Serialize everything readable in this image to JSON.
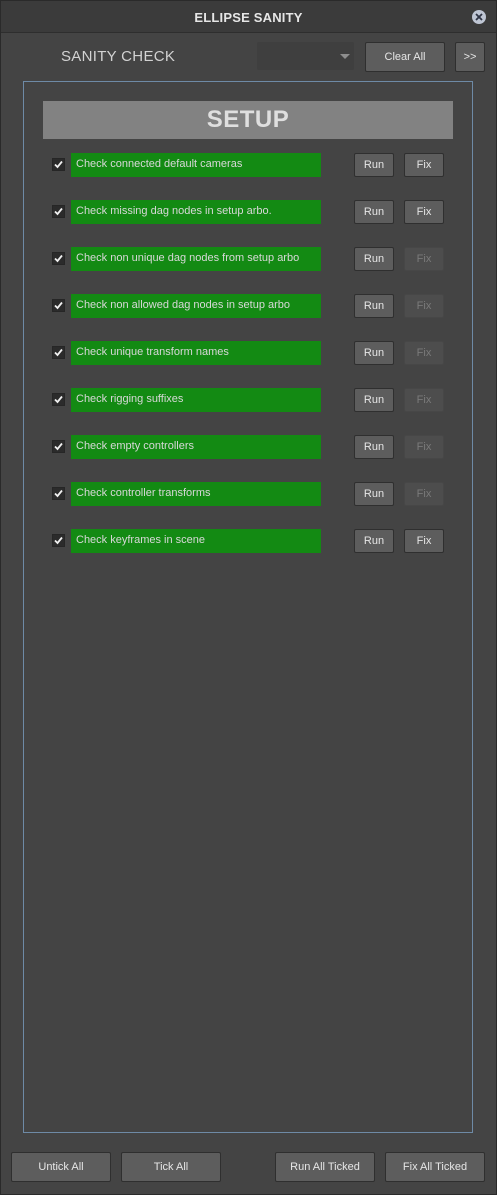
{
  "window": {
    "title": "ELLIPSE SANITY",
    "close_icon": "close-icon"
  },
  "toolbar": {
    "heading": "SANITY CHECK",
    "combo_value": "",
    "clear_all_label": "Clear All",
    "more_label": ">>"
  },
  "section": {
    "title": "SETUP"
  },
  "checks": [
    {
      "label": "Check connected default cameras",
      "checked": true,
      "run_label": "Run",
      "fix_label": "Fix",
      "fix_enabled": true
    },
    {
      "label": "Check missing dag nodes in setup arbo.",
      "checked": true,
      "run_label": "Run",
      "fix_label": "Fix",
      "fix_enabled": true
    },
    {
      "label": "Check non unique dag nodes from setup arbo",
      "checked": true,
      "run_label": "Run",
      "fix_label": "Fix",
      "fix_enabled": false
    },
    {
      "label": "Check non allowed dag nodes in setup arbo",
      "checked": true,
      "run_label": "Run",
      "fix_label": "Fix",
      "fix_enabled": false
    },
    {
      "label": "Check unique transform names",
      "checked": true,
      "run_label": "Run",
      "fix_label": "Fix",
      "fix_enabled": false
    },
    {
      "label": "Check rigging suffixes",
      "checked": true,
      "run_label": "Run",
      "fix_label": "Fix",
      "fix_enabled": false
    },
    {
      "label": "Check empty controllers",
      "checked": true,
      "run_label": "Run",
      "fix_label": "Fix",
      "fix_enabled": false
    },
    {
      "label": "Check controller transforms",
      "checked": true,
      "run_label": "Run",
      "fix_label": "Fix",
      "fix_enabled": false
    },
    {
      "label": "Check keyframes in scene",
      "checked": true,
      "run_label": "Run",
      "fix_label": "Fix",
      "fix_enabled": true
    }
  ],
  "footer": {
    "untick_all_label": "Untick All",
    "tick_all_label": "Tick All",
    "run_all_label": "Run All Ticked",
    "fix_all_label": "Fix All Ticked"
  },
  "colors": {
    "background": "#444444",
    "check_label_bg": "#138a13",
    "frame_border": "#6e8aa6",
    "section_header_bg": "#828282"
  }
}
